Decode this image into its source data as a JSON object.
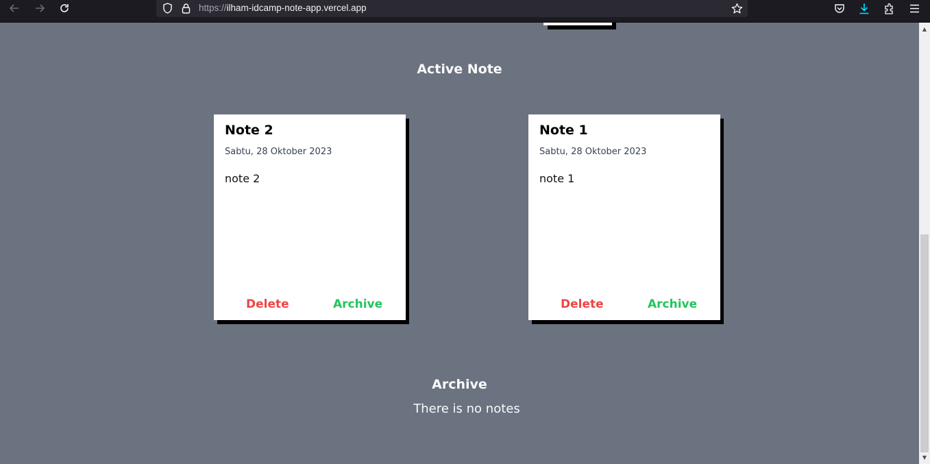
{
  "browser": {
    "url_scheme": "https://",
    "url_host": "ilham-idcamp-note-app.vercel.app",
    "icons": {
      "back": "arrow-left-icon",
      "forward": "arrow-right-icon",
      "reload": "reload-icon",
      "tracking": "shield-icon",
      "secure": "lock-icon",
      "bookmark": "star-icon",
      "pocket": "pocket-icon",
      "downloads": "download-icon",
      "extensions": "puzzle-icon",
      "menu": "hamburger-icon"
    }
  },
  "active_section": {
    "title": "Active Note",
    "notes": [
      {
        "title": "Note 2",
        "date": "Sabtu, 28 Oktober 2023",
        "body": "note 2",
        "delete_label": "Delete",
        "archive_label": "Archive"
      },
      {
        "title": "Note 1",
        "date": "Sabtu, 28 Oktober 2023",
        "body": "note 1",
        "delete_label": "Delete",
        "archive_label": "Archive"
      }
    ]
  },
  "archive_section": {
    "title": "Archive",
    "empty_message": "There is no notes"
  },
  "colors": {
    "page_background": "#6b7280",
    "card_background": "#ffffff",
    "delete": "#ef4444",
    "archive": "#22c55e"
  }
}
